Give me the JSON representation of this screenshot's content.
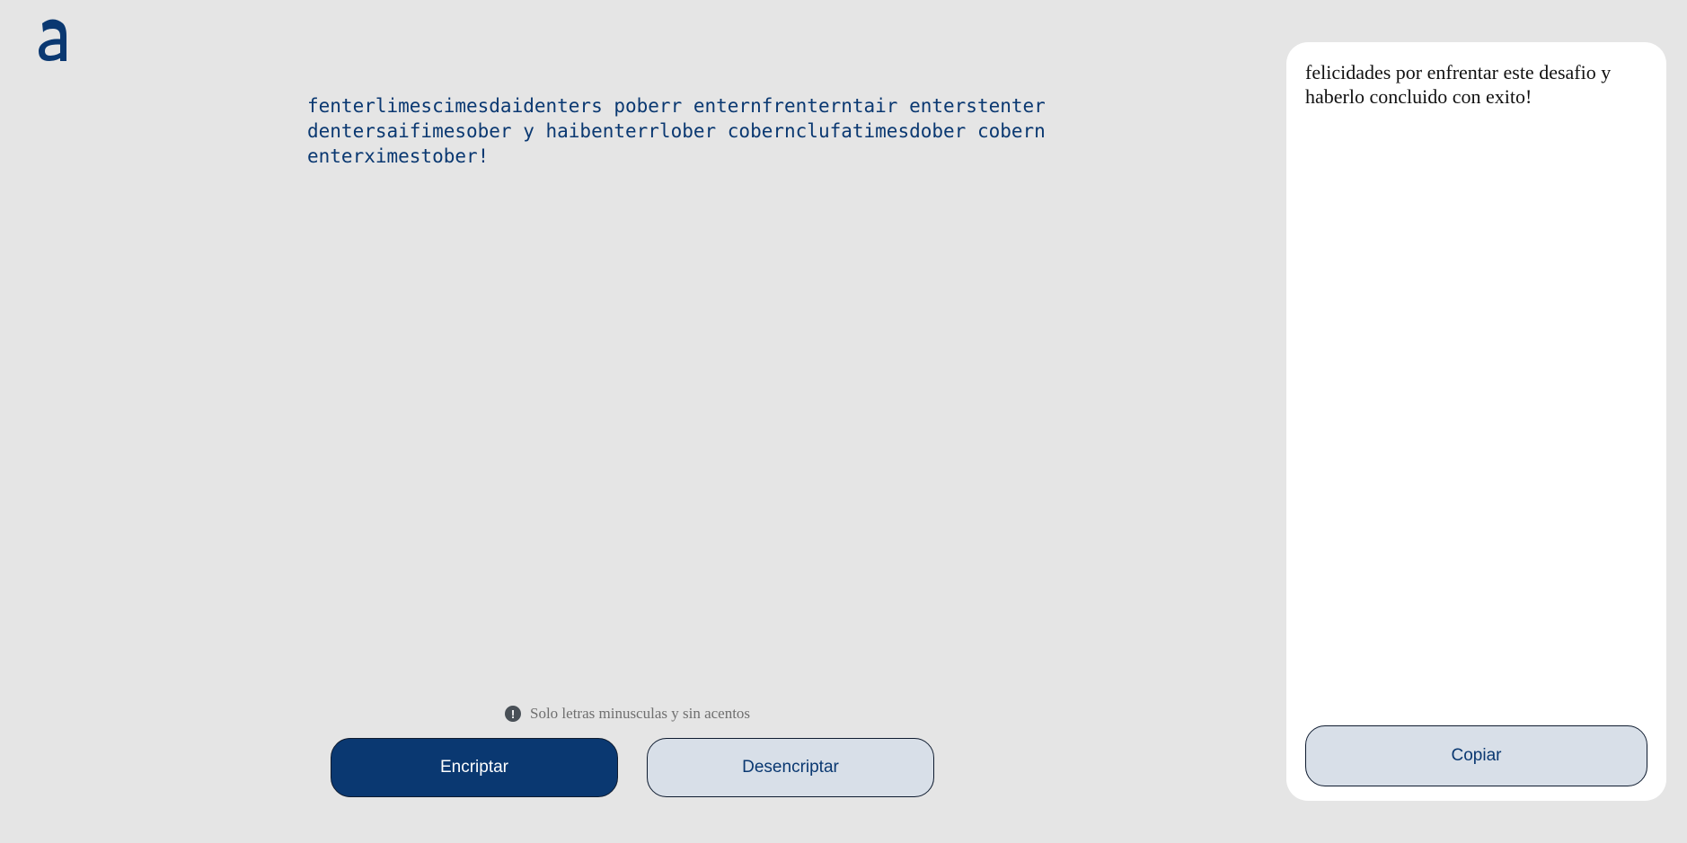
{
  "brand": {
    "logo_icon": "alura-a-logo-icon",
    "accent_color": "#0a3871"
  },
  "input": {
    "value": "fenterlimescimesdaidenters poberr enternfrenterntair enterstenter dentersaifimesober y haibenterrlober cobernclufatimesdober cobern enterximestober!"
  },
  "warning": {
    "icon": "exclamation-circle-icon",
    "text": "Solo letras minusculas y sin acentos"
  },
  "actions": {
    "encrypt_label": "Encriptar",
    "decrypt_label": "Desencriptar"
  },
  "output": {
    "text": "felicidades por enfrentar este desafio y haberlo concluido con exito!",
    "copy_label": "Copiar"
  }
}
